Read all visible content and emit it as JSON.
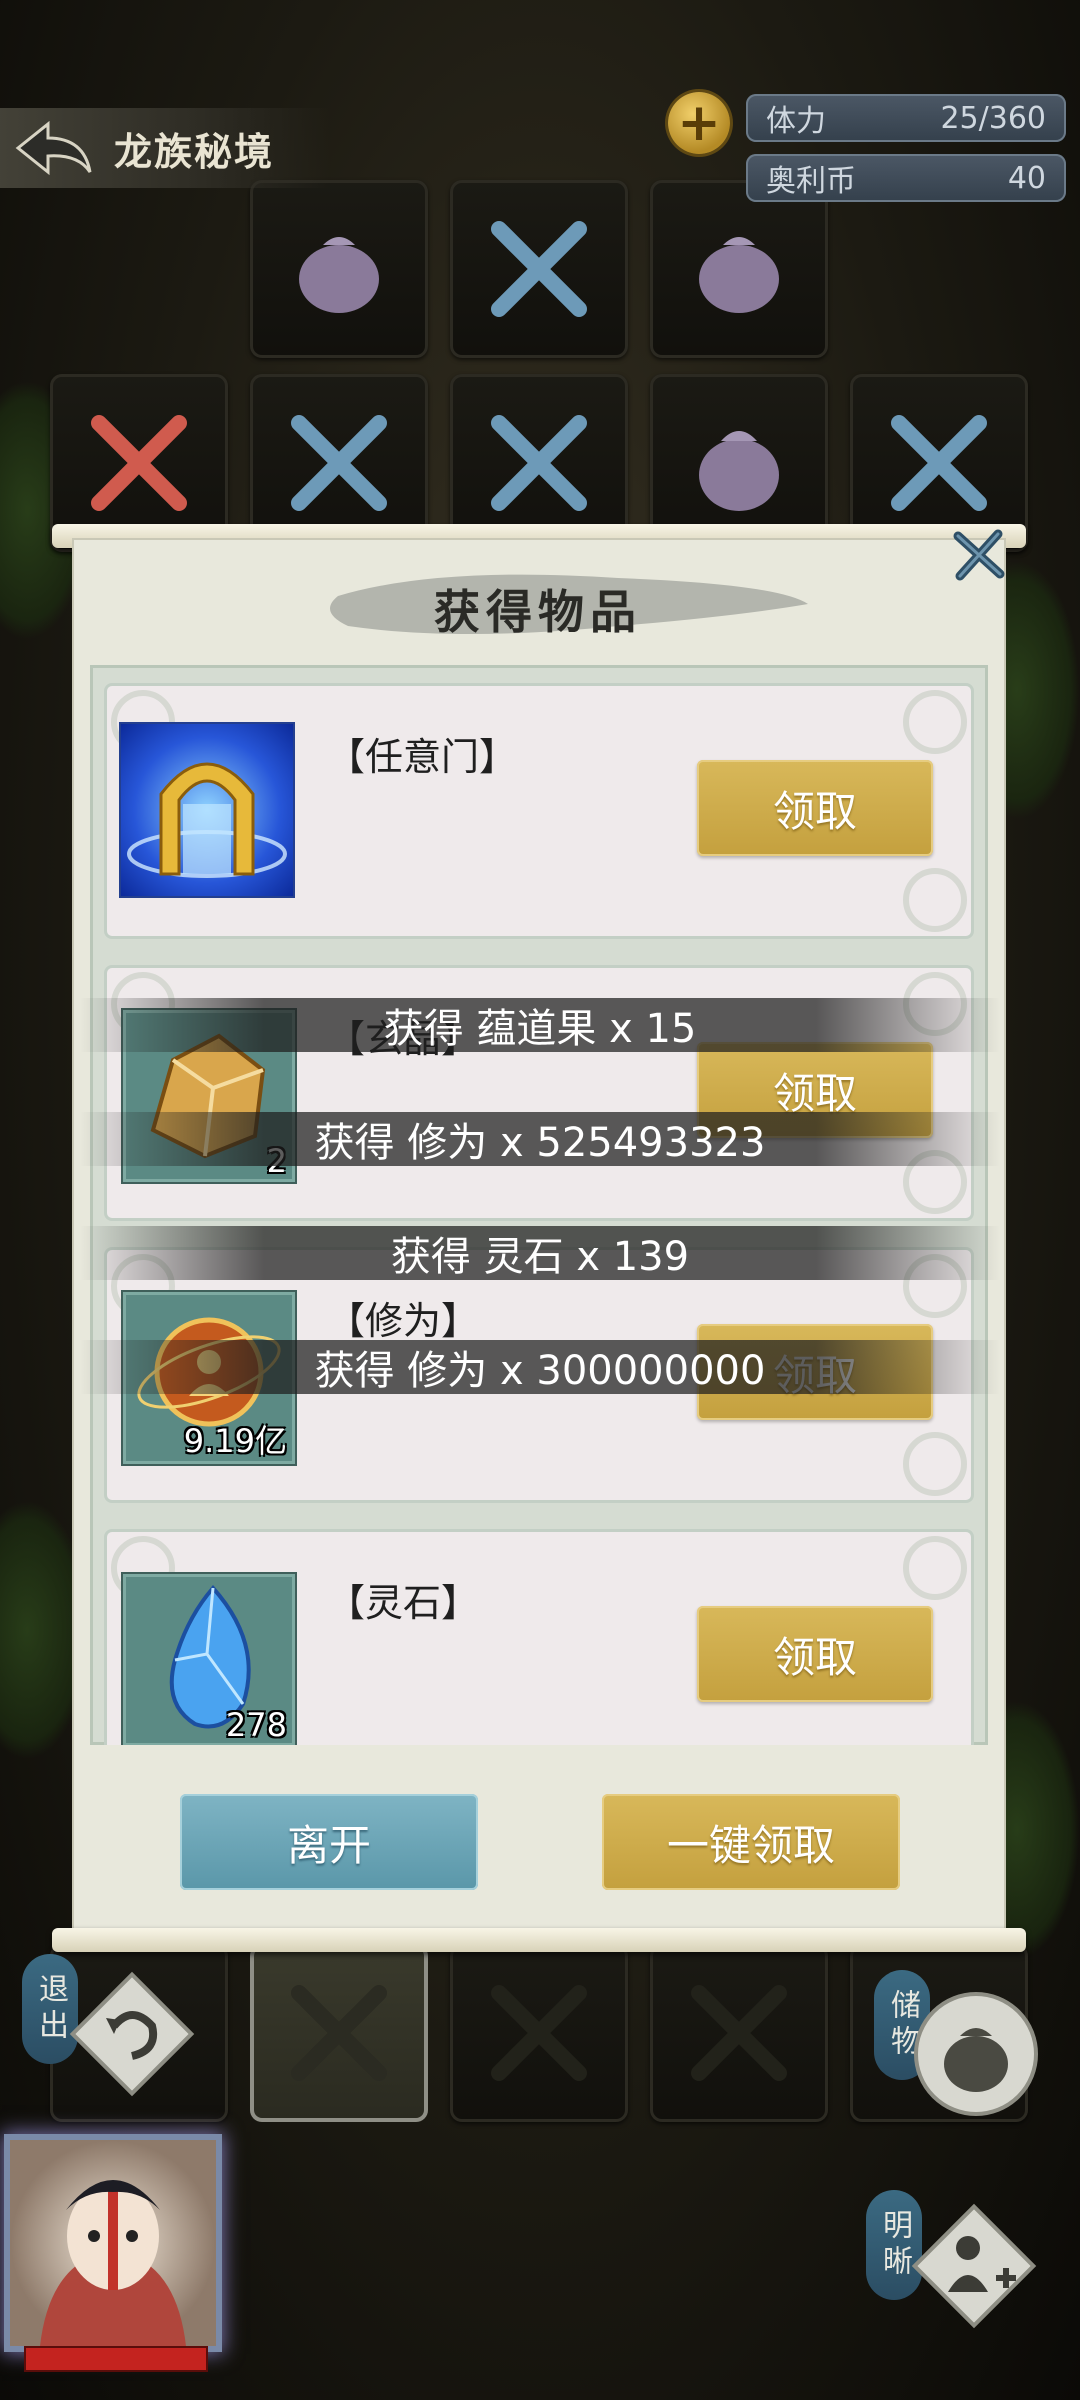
{
  "hud": {
    "title": "龙族秘境",
    "stamina_label": "体力",
    "stamina_value": "25/360",
    "coin_label": "奥利币",
    "coin_value": "40",
    "add_label": "+"
  },
  "dialog": {
    "title": "获得物品",
    "items": [
      {
        "name": "【任意门】",
        "count": "",
        "icon": "golden-gate-icon",
        "claim_label": "领取"
      },
      {
        "name": "【玄晶】",
        "count": "2",
        "icon": "crystal-ore-icon",
        "claim_label": "领取"
      },
      {
        "name": "【修为】",
        "count": "9.19亿",
        "icon": "cultivation-orb-icon",
        "claim_label": "领取"
      },
      {
        "name": "【灵石】",
        "count": "278",
        "icon": "spirit-stone-icon",
        "claim_label": "领取"
      }
    ],
    "leave_label": "离开",
    "claim_all_label": "一键领取"
  },
  "toasts": [
    "获得 蕴道果 x 15",
    "获得 修为 x 525493323",
    "获得 灵石 x 139",
    "获得 修为 x 300000000"
  ],
  "controls": {
    "exit_label": "退出",
    "storage_label": "储物",
    "clarity_label": "明晰"
  },
  "colors": {
    "gold_button": "#c9a744",
    "blue_button": "#6aa5b6",
    "hp_red": "#c4231f"
  }
}
